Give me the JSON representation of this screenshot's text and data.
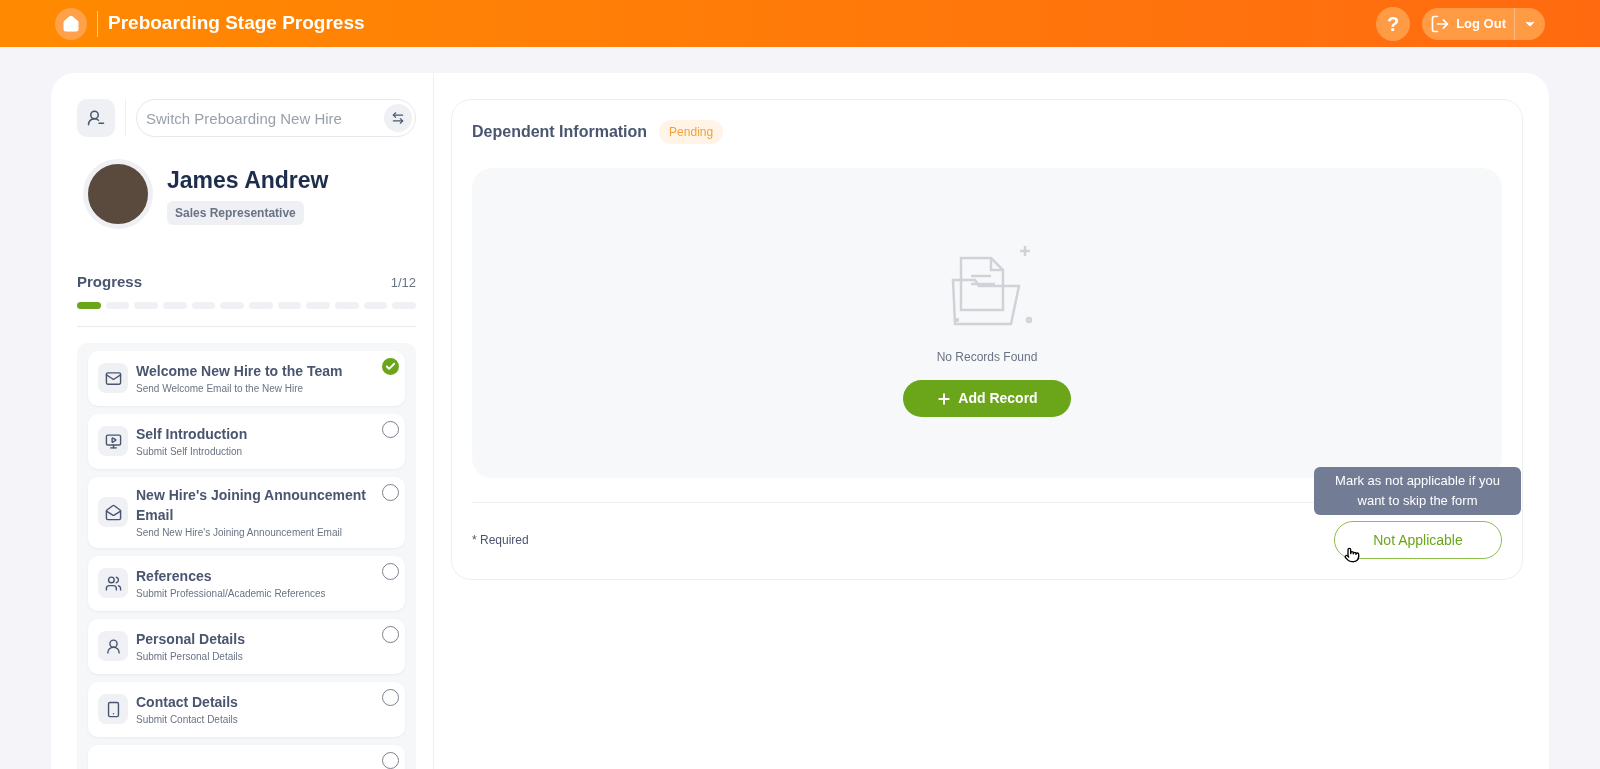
{
  "header": {
    "title": "Preboarding Stage Progress",
    "help": "?",
    "logout": "Log Out"
  },
  "sidebar": {
    "search": {
      "placeholder": "Switch Preboarding New Hire"
    },
    "profile": {
      "name": "James Andrew",
      "role": "Sales Representative"
    },
    "progress": {
      "label": "Progress",
      "count": "1/12",
      "segments": [
        {
          "done": true
        },
        {
          "done": false
        },
        {
          "done": false
        },
        {
          "done": false
        },
        {
          "done": false
        },
        {
          "done": false
        },
        {
          "done": false
        },
        {
          "done": false
        },
        {
          "done": false
        },
        {
          "done": false
        },
        {
          "done": false
        },
        {
          "done": false
        }
      ]
    },
    "tasks": [
      {
        "kind": "mail",
        "title": "Welcome New Hire to the Team",
        "subtitle": "Send Welcome Email to the New Hire",
        "checked": true
      },
      {
        "kind": "video",
        "title": "Self Introduction",
        "subtitle": "Submit Self Introduction",
        "checked": false
      },
      {
        "kind": "envelope",
        "title": "New Hire's Joining Announcement Email",
        "subtitle": "Send New Hire's Joining Announcement Email",
        "checked": false
      },
      {
        "kind": "people",
        "title": "References",
        "subtitle": "Submit Professional/Academic References",
        "checked": false
      },
      {
        "kind": "person",
        "title": "Personal Details",
        "subtitle": "Submit Personal Details",
        "checked": false
      },
      {
        "kind": "phone",
        "title": "Contact Details",
        "subtitle": "Submit Contact Details",
        "checked": false
      },
      {
        "kind": "cut",
        "checked": false
      }
    ]
  },
  "panel": {
    "title": "Dependent Information",
    "status": "Pending",
    "empty_text": "No Records Found",
    "add_button": "Add Record",
    "required_note": "* Required",
    "tooltip": "Mark as not applicable if you want to skip the form",
    "not_applicable_button": "Not Applicable"
  }
}
